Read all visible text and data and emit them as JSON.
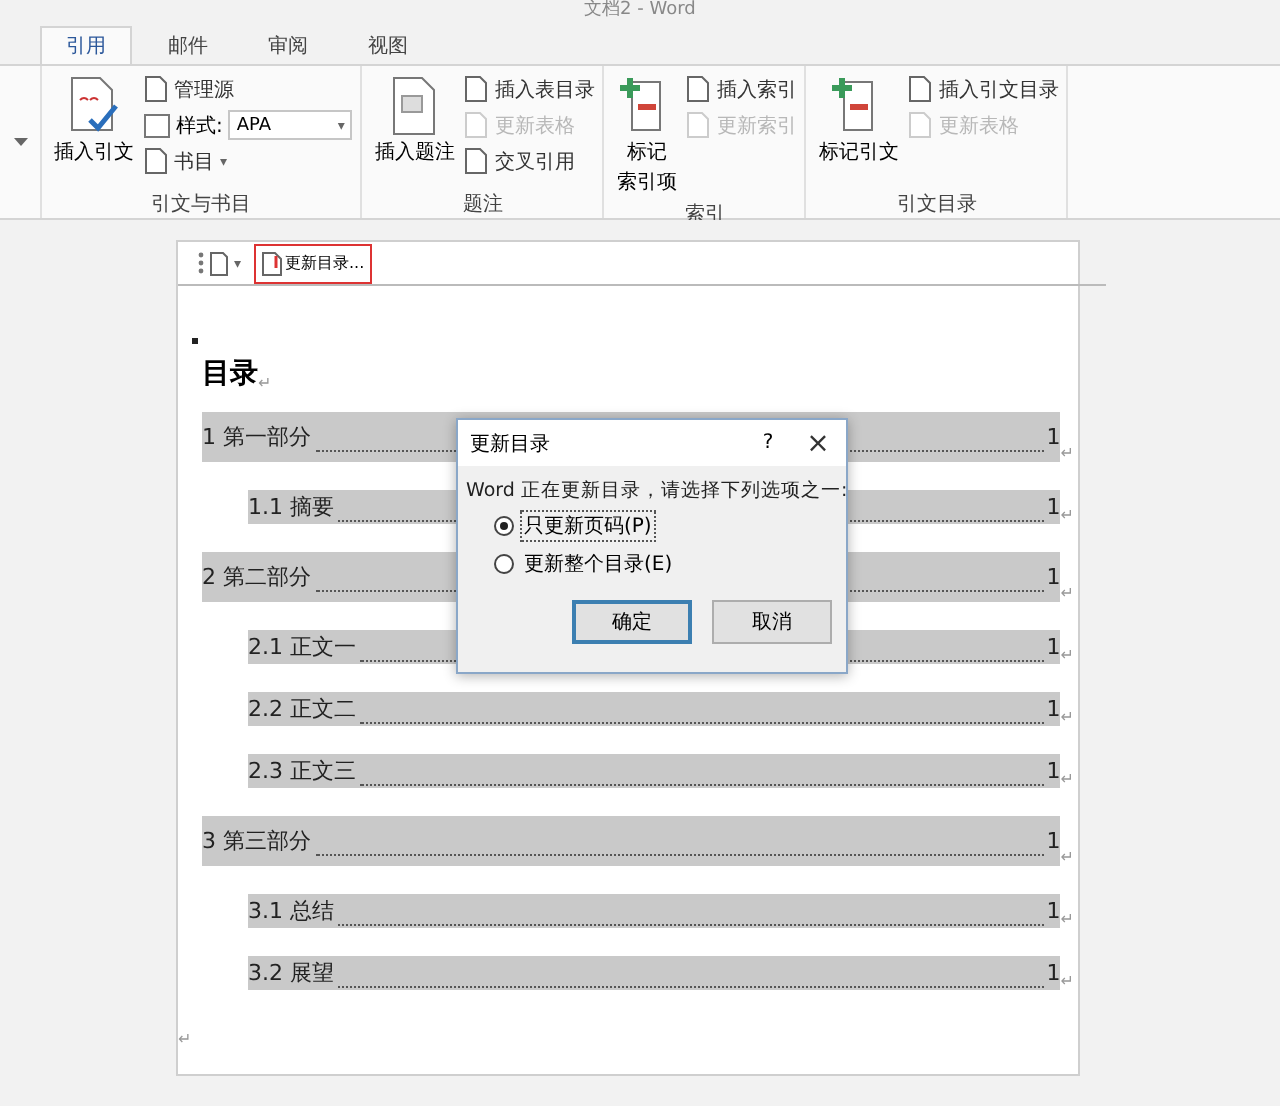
{
  "window": {
    "title": "文档2 - Word"
  },
  "tabs": [
    {
      "label": "引用",
      "selected": true
    },
    {
      "label": "邮件",
      "selected": false
    },
    {
      "label": "审阅",
      "selected": false
    },
    {
      "label": "视图",
      "selected": false
    }
  ],
  "ribbon": {
    "groups": [
      {
        "label": "引文与书目",
        "large": {
          "lines": [
            "插入引文"
          ],
          "kind": "citation"
        },
        "items": [
          {
            "kind": "button",
            "label": "管理源",
            "disabled": false
          },
          {
            "kind": "style",
            "label": "样式:",
            "value": "APA",
            "caret": "▾"
          },
          {
            "kind": "menu",
            "label": "书目",
            "caret": "▾",
            "disabled": false
          }
        ]
      },
      {
        "label": "题注",
        "large": {
          "lines": [
            "插入题注"
          ],
          "kind": "caption"
        },
        "items": [
          {
            "kind": "button",
            "label": "插入表目录",
            "disabled": false
          },
          {
            "kind": "button",
            "label": "更新表格",
            "disabled": true
          },
          {
            "kind": "button",
            "label": "交叉引用",
            "disabled": false
          }
        ]
      },
      {
        "label": "索引",
        "large": {
          "lines": [
            "标记",
            "索引项"
          ],
          "kind": "mark"
        },
        "items": [
          {
            "kind": "button",
            "label": "插入索引",
            "disabled": false
          },
          {
            "kind": "button",
            "label": "更新索引",
            "disabled": true
          }
        ]
      },
      {
        "label": "引文目录",
        "large": {
          "lines": [
            "标记引文"
          ],
          "kind": "mark"
        },
        "items": [
          {
            "kind": "button",
            "label": "插入引文目录",
            "disabled": false
          },
          {
            "kind": "button",
            "label": "更新表格",
            "disabled": true
          }
        ]
      }
    ]
  },
  "content_control": {
    "caret": "▾",
    "update_button": "更新目录..."
  },
  "document": {
    "heading": "目录",
    "mark": "↵",
    "toc": [
      {
        "title": "1 第一部分",
        "page": "1",
        "children": [
          {
            "title": "1.1 摘要",
            "page": "1"
          }
        ]
      },
      {
        "title": "2 第二部分",
        "page": "1",
        "children": [
          {
            "title": "2.1 正文一",
            "page": "1"
          },
          {
            "title": "2.2 正文二",
            "page": "1"
          },
          {
            "title": "2.3 正文三",
            "page": "1"
          }
        ]
      },
      {
        "title": "3 第三部分",
        "page": "1",
        "children": [
          {
            "title": "3.1 总结",
            "page": "1"
          },
          {
            "title": "3.2 展望",
            "page": "1"
          }
        ]
      }
    ]
  },
  "dialog": {
    "title": "更新目录",
    "help": "?",
    "close": "×",
    "message": "Word 正在更新目录，请选择下列选项之一:",
    "options": [
      {
        "label": "只更新页码(P)",
        "selected": true
      },
      {
        "label": "更新整个目录(E)",
        "selected": false
      }
    ],
    "buttons": [
      {
        "label": "确定",
        "default": true
      },
      {
        "label": "取消",
        "default": false
      }
    ]
  }
}
